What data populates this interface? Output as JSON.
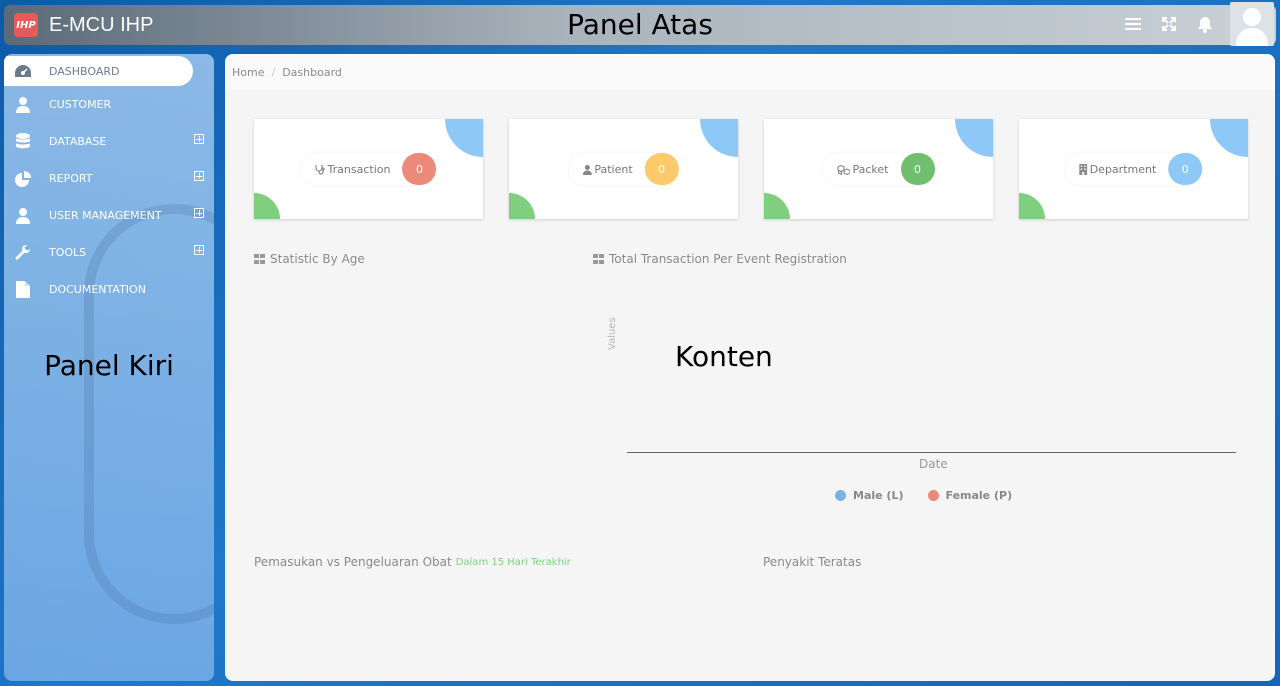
{
  "topbar": {
    "logo_text": "IHP",
    "app_title": "E-MCU IHP",
    "annotation": "Panel Atas",
    "icons": [
      "menu-icon",
      "fullscreen-icon",
      "bell-icon"
    ]
  },
  "sidebar": {
    "annotation": "Panel Kiri",
    "items": [
      {
        "label": "DASHBOARD",
        "icon": "dashboard-icon",
        "active": true
      },
      {
        "label": "CUSTOMER",
        "icon": "user-icon"
      },
      {
        "label": "DATABASE",
        "icon": "database-icon",
        "expandable": true
      },
      {
        "label": "REPORT",
        "icon": "pie-chart-icon",
        "expandable": true
      },
      {
        "label": "USER MANAGEMENT",
        "icon": "user-icon",
        "expandable": true
      },
      {
        "label": "TOOLS",
        "icon": "wrench-icon",
        "expandable": true
      },
      {
        "label": "DOCUMENTATION",
        "icon": "file-icon"
      }
    ]
  },
  "breadcrumb": {
    "home": "Home",
    "current": "Dashboard"
  },
  "cards": [
    {
      "label": "Transaction",
      "value": "0",
      "color": "#ec8a7a",
      "icon": "stethoscope-icon"
    },
    {
      "label": "Patient",
      "value": "0",
      "color": "#fcc96b",
      "icon": "user-icon"
    },
    {
      "label": "Packet",
      "value": "0",
      "color": "#6fbf6f",
      "icon": "cubes-icon"
    },
    {
      "label": "Department",
      "value": "0",
      "color": "#8ec8f7",
      "icon": "building-icon"
    }
  ],
  "sections": {
    "age": "Statistic By Age",
    "event": "Total Transaction Per Event Registration",
    "content_annotation": "Konten",
    "medicine": "Pemasukan vs Pengeluaran Obat",
    "medicine_sub": "Dalam 15 Hari Terakhir",
    "disease": "Penyakit Teratas"
  },
  "chart": {
    "ylabel": "Values",
    "xlabel": "Date",
    "legend": [
      {
        "name": "Male (L)",
        "color": "#7ab3e0"
      },
      {
        "name": "Female (P)",
        "color": "#ec8a7a"
      }
    ]
  }
}
